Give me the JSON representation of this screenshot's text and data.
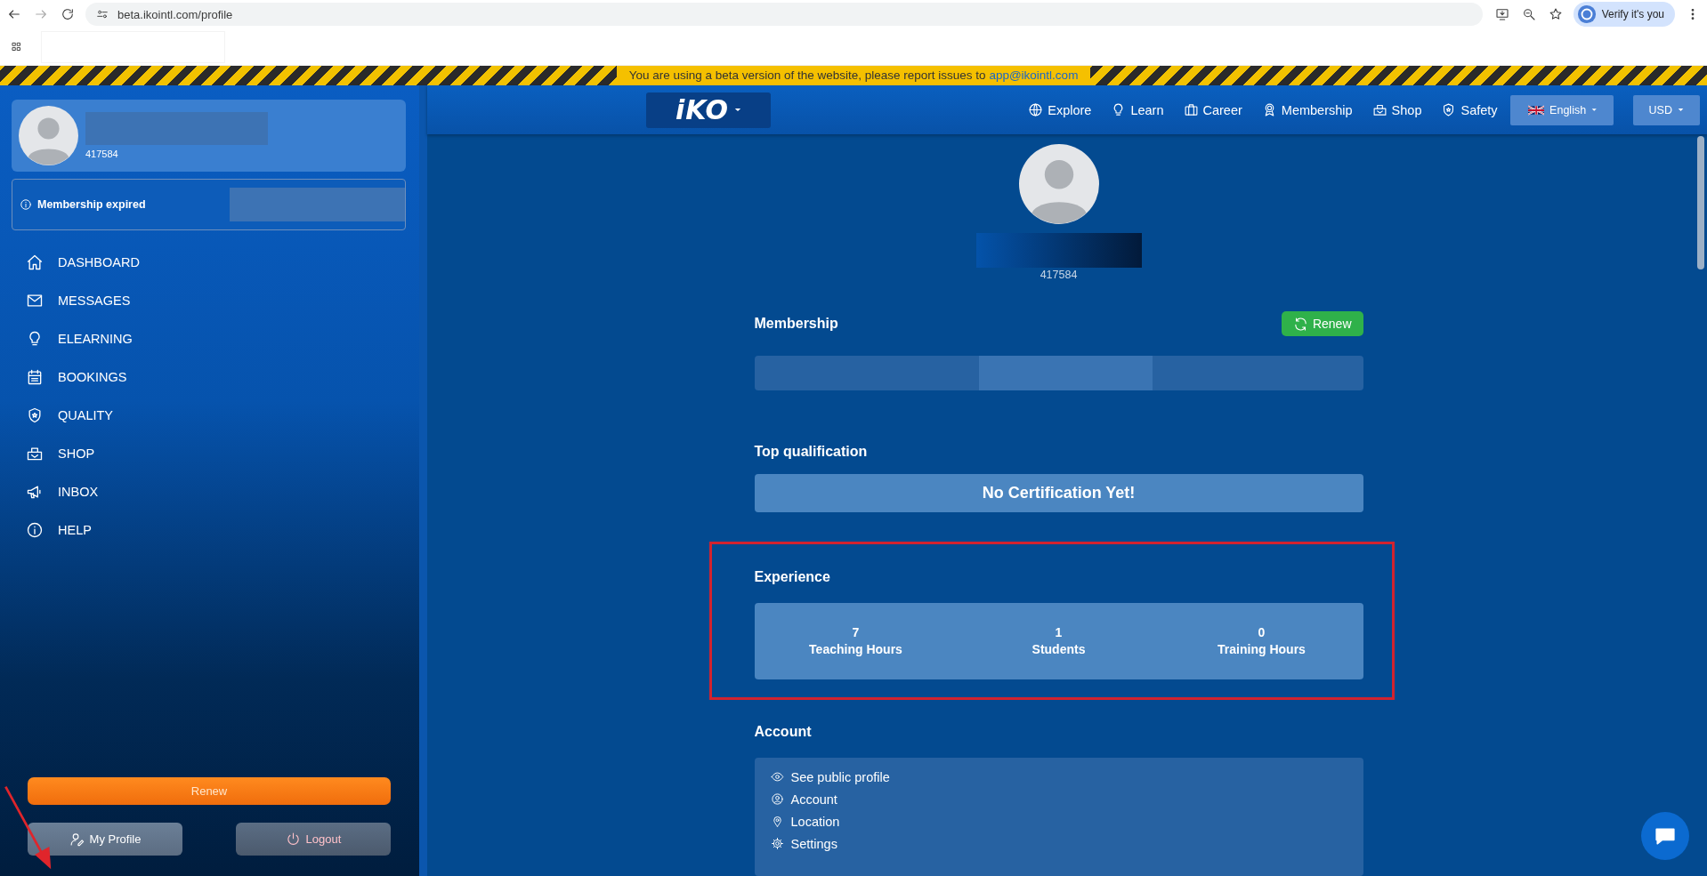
{
  "browser": {
    "url": "beta.ikointl.com/profile",
    "profile_button": "Verify it's you"
  },
  "banner": {
    "text": "You are using a beta version of the website, please report issues to ",
    "link": "app@ikointl.com"
  },
  "sidebar": {
    "member_id": "417584",
    "alert": "Membership expired",
    "nav": [
      {
        "label": "DASHBOARD"
      },
      {
        "label": "MESSAGES"
      },
      {
        "label": "ELEARNING"
      },
      {
        "label": "BOOKINGS"
      },
      {
        "label": "QUALITY"
      },
      {
        "label": "SHOP"
      },
      {
        "label": "INBOX"
      },
      {
        "label": "HELP"
      }
    ],
    "renew": "Renew",
    "my_profile": "My Profile",
    "logout": "Logout"
  },
  "header": {
    "logo": "iKO",
    "nav": [
      {
        "label": "Explore"
      },
      {
        "label": "Learn"
      },
      {
        "label": "Career"
      },
      {
        "label": "Membership"
      },
      {
        "label": "Shop"
      },
      {
        "label": "Safety"
      }
    ],
    "language": "English",
    "currency": "USD"
  },
  "profile": {
    "member_id": "417584",
    "membership": {
      "title": "Membership",
      "renew": "Renew"
    },
    "top_qualification": {
      "title": "Top qualification",
      "text": "No Certification Yet!"
    },
    "experience": {
      "title": "Experience",
      "stats": [
        {
          "value": "7",
          "label": "Teaching Hours"
        },
        {
          "value": "1",
          "label": "Students"
        },
        {
          "value": "0",
          "label": "Training Hours"
        }
      ]
    },
    "account": {
      "title": "Account",
      "links": [
        {
          "label": "See public profile"
        },
        {
          "label": "Account"
        },
        {
          "label": "Location"
        },
        {
          "label": "Settings"
        }
      ]
    }
  }
}
